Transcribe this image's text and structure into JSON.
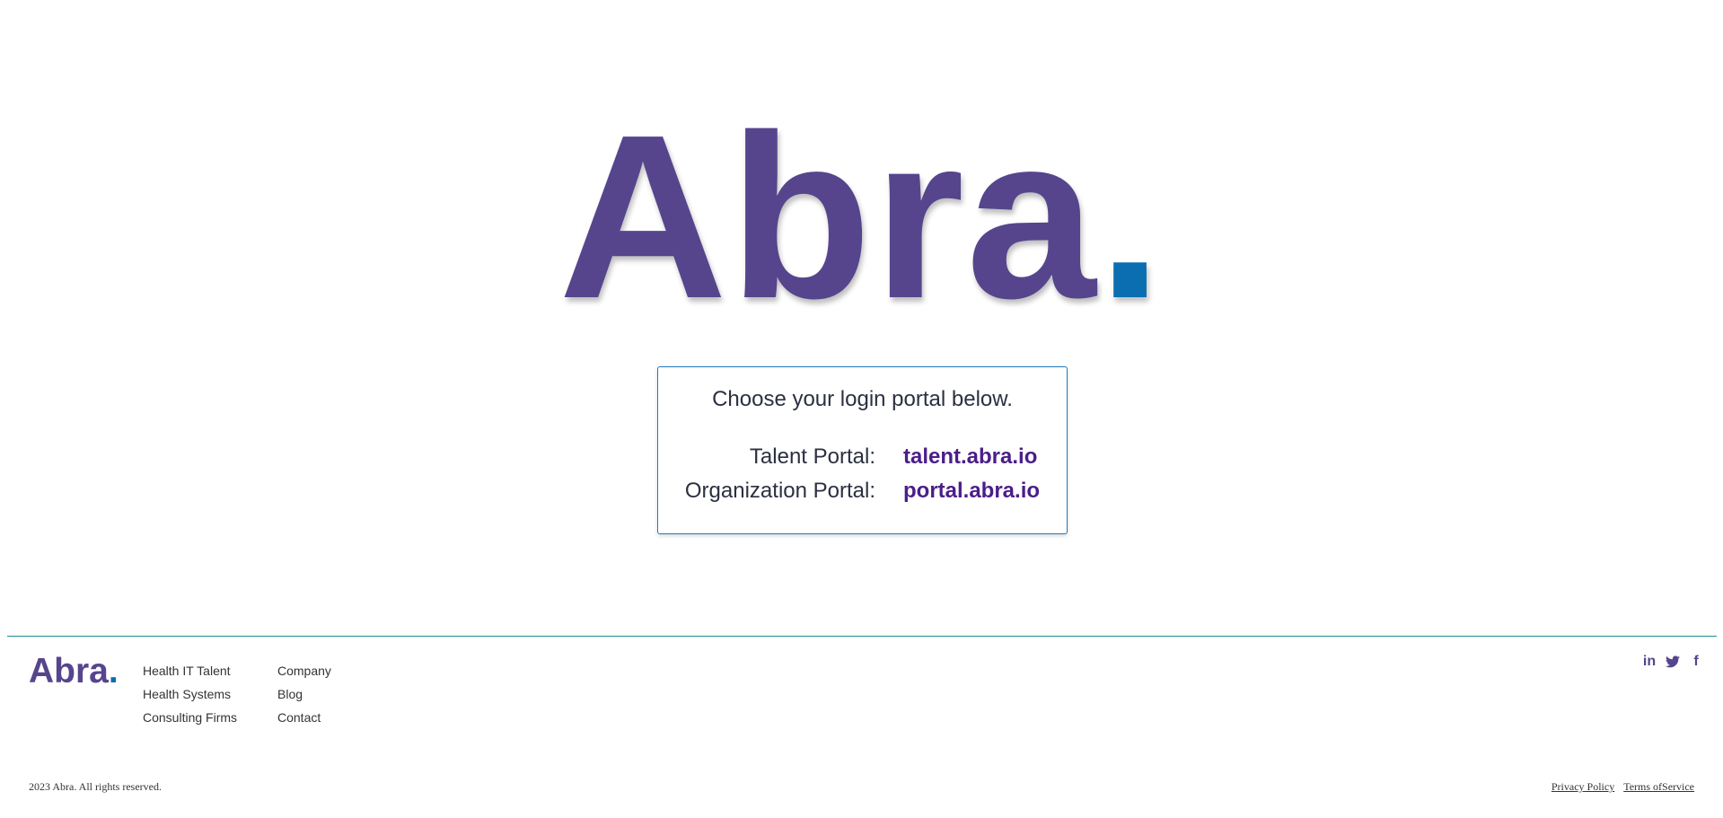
{
  "hero": {
    "logo_text": "Abra",
    "logo_dot": "."
  },
  "portal": {
    "intro": "Choose your login portal below.",
    "rows": [
      {
        "label": "Talent Portal:",
        "link": "talent.abra.io"
      },
      {
        "label": "Organization Portal:",
        "link": "portal.abra.io"
      }
    ]
  },
  "footer": {
    "logo_text": "Abra",
    "logo_dot": ".",
    "col1": [
      "Health IT Talent",
      "Health Systems",
      "Consulting Firms"
    ],
    "col2": [
      "Company",
      "Blog",
      "Contact"
    ],
    "social": [
      {
        "icon": "linkedin-icon",
        "glyph": "in"
      },
      {
        "icon": "twitter-icon",
        "glyph": ""
      },
      {
        "icon": "facebook-icon",
        "glyph": "f"
      }
    ],
    "copyright": "2023 Abra. All rights reserved.",
    "legal": [
      "Privacy Policy",
      "Terms ofService"
    ]
  },
  "colors": {
    "brand_purple": "#56458c",
    "brand_blue": "#0a6eb0",
    "link_purple": "#4b1e8a",
    "divider_teal": "#178f94"
  }
}
